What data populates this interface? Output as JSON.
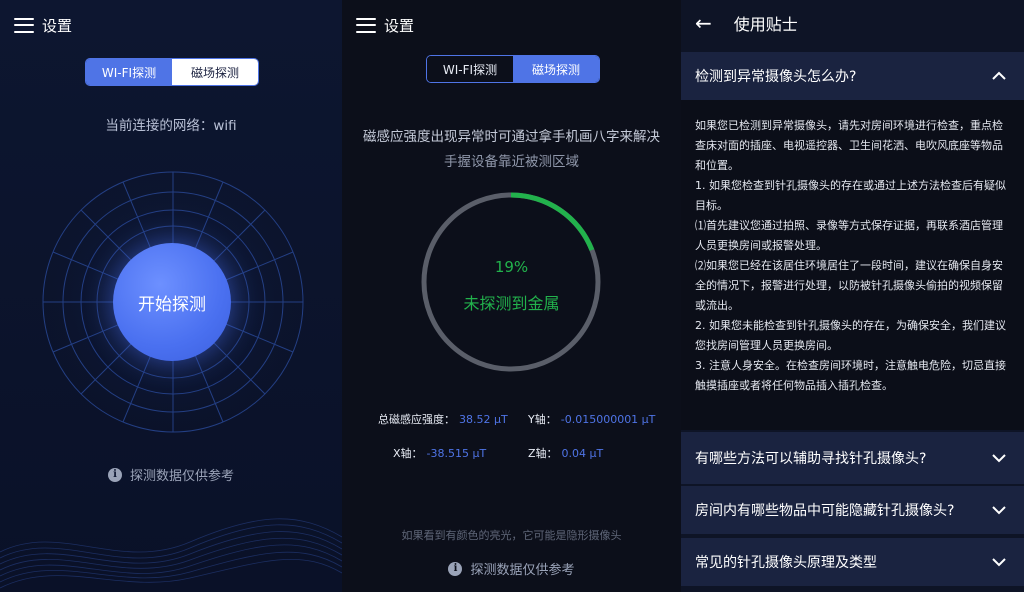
{
  "panel1": {
    "menu_title": "设置",
    "tabs": [
      {
        "label": "WI-FI探测",
        "active": true
      },
      {
        "label": "磁场探测",
        "active": false
      }
    ],
    "network_text": "当前连接的网络：wifi",
    "start_button": "开始探测",
    "note": "探测数据仅供参考"
  },
  "panel2": {
    "menu_title": "设置",
    "tabs": [
      {
        "label": "WI-FI探测",
        "active": false
      },
      {
        "label": "磁场探测",
        "active": true
      }
    ],
    "hint_line1": "磁感应强度出现异常时可通过拿手机画八字来解决",
    "hint_line2": "手握设备靠近被测区域",
    "progress_value": 0.19,
    "progress_text": "19%",
    "status_text": "未探测到金属",
    "readings": {
      "total": {
        "label": "总磁感应强度：",
        "value": "38.52 μT"
      },
      "y": {
        "label": "Y轴：",
        "value": "-0.015000001 μT"
      },
      "x": {
        "label": "X轴：",
        "value": "-38.515 μT"
      },
      "z": {
        "label": "Z轴：",
        "value": "0.04 μT"
      }
    },
    "bottom_hint": "如果看到有颜色的亮光，它可能是隐形摄像头",
    "note": "探测数据仅供参考"
  },
  "panel3": {
    "title": "使用贴士",
    "sections": [
      {
        "heading": "检测到异常摄像头怎么办?",
        "expanded": true,
        "paragraphs": [
          "如果您已检测到异常摄像头，请先对房间环境进行检查，重点检查床对面的插座、电视遥控器、卫生间花洒、电吹风底座等物品和位置。",
          "1. 如果您检查到针孔摄像头的存在或通过上述方法检查后有疑似目标。",
          "⑴首先建议您通过拍照、录像等方式保存证据，再联系酒店管理人员更换房间或报警处理。",
          "⑵如果您已经在该居住环境居住了一段时间，建议在确保自身安全的情况下，报警进行处理，以防被针孔摄像头偷拍的视频保留或流出。",
          "2. 如果您未能检查到针孔摄像头的存在，为确保安全，我们建议您找房间管理人员更换房间。",
          "3. 注意人身安全。在检查房间环境时，注意触电危险，切忌直接触摸插座或者将任何物品插入插孔检查。"
        ]
      },
      {
        "heading": "有哪些方法可以辅助寻找针孔摄像头?",
        "expanded": false
      },
      {
        "heading": "房间内有哪些物品中可能隐藏针孔摄像头?",
        "expanded": false
      },
      {
        "heading": "常见的针孔摄像头原理及类型",
        "expanded": false
      }
    ]
  },
  "colors": {
    "accent": "#4f74e6",
    "success": "#22b24c",
    "panel_header": "#1a2340"
  }
}
